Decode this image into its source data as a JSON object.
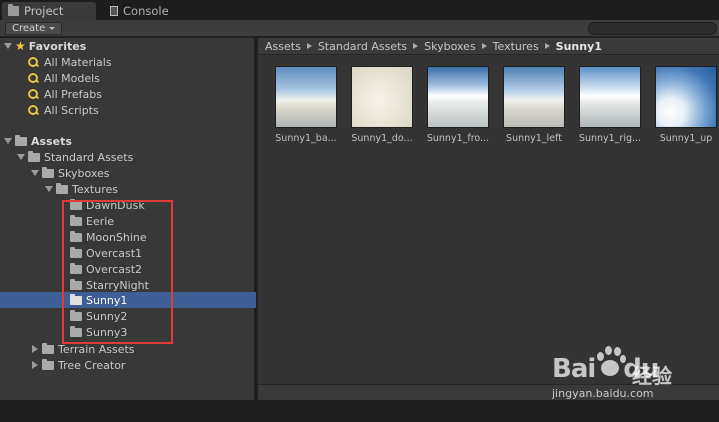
{
  "tabs": [
    {
      "label": "Project",
      "active": true
    },
    {
      "label": "Console",
      "active": false
    }
  ],
  "toolbar": {
    "create_label": "Create",
    "search_placeholder": ""
  },
  "favorites": {
    "label": "Favorites",
    "items": [
      "All Materials",
      "All Models",
      "All Prefabs",
      "All Scripts"
    ]
  },
  "assets": {
    "label": "Assets",
    "standard_assets": "Standard Assets",
    "skyboxes": "Skyboxes",
    "textures": "Textures",
    "texture_folders": [
      "DawnDusk",
      "Eerie",
      "MoonShine",
      "Overcast1",
      "Overcast2",
      "StarryNight",
      "Sunny1",
      "Sunny2",
      "Sunny3"
    ],
    "selected": "Sunny1",
    "terrain_assets": "Terrain Assets",
    "tree_creator": "Tree Creator"
  },
  "breadcrumb": [
    "Assets",
    "Standard Assets",
    "Skyboxes",
    "Textures",
    "Sunny1"
  ],
  "thumbnails": [
    {
      "label": "Sunny1_ba..."
    },
    {
      "label": "Sunny1_do..."
    },
    {
      "label": "Sunny1_fro..."
    },
    {
      "label": "Sunny1_left"
    },
    {
      "label": "Sunny1_rig..."
    },
    {
      "label": "Sunny1_up"
    }
  ],
  "watermark": {
    "logo": "Bai",
    "logo_suffix": "du",
    "cn": "经验",
    "url": "jingyan.baidu.com"
  },
  "colors": {
    "selection": "#3e5e96",
    "highlight_box": "#e03a3a",
    "favorite_star": "#f4c542"
  }
}
